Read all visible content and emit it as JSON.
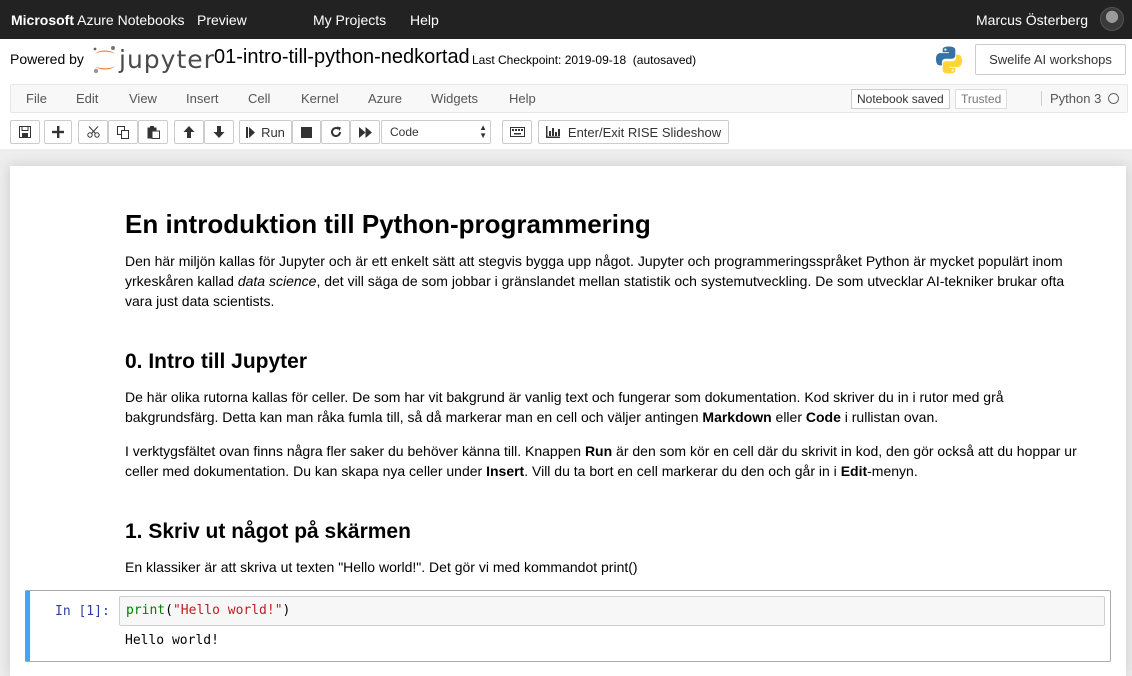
{
  "azure_bar": {
    "brand_bold": "Microsoft",
    "brand_rest": "Azure Notebooks",
    "preview": "Preview",
    "my_projects": "My Projects",
    "help": "Help",
    "user": "Marcus Österberg"
  },
  "header": {
    "powered_by": "Powered by",
    "logo_text": "jupyter",
    "notebook_name": "01-intro-till-python-nedkortad",
    "checkpoint_label": "Last Checkpoint:",
    "checkpoint_date": "2019-09-18",
    "autosaved": "(autosaved)",
    "workshop_button": "Swelife AI workshops"
  },
  "menubar": {
    "items": [
      "File",
      "Edit",
      "View",
      "Insert",
      "Cell",
      "Kernel",
      "Azure",
      "Widgets",
      "Help"
    ],
    "notebook_saved": "Notebook saved",
    "trusted": "Trusted",
    "kernel": "Python 3"
  },
  "toolbar": {
    "run_label": "Run",
    "cell_type": "Code",
    "rise_label": "Enter/Exit RISE Slideshow"
  },
  "content": {
    "title": "En introduktion till Python-programmering",
    "intro_1": "Den här miljön kallas för Jupyter och är ett enkelt sätt att stegvis bygga upp något. Jupyter och programmeringsspråket Python är mycket populärt inom yrkeskåren kallad ",
    "intro_em": "data science",
    "intro_2": ", det vill säga de som jobbar i gränslandet mellan statistik och systemutveckling. De som utvecklar AI-tekniker brukar ofta vara just data scientists.",
    "section0_title": "0. Intro till Jupyter",
    "s0p1_a": "De här olika rutorna kallas för celler. De som har vit bakgrund är vanlig text och fungerar som dokumentation. Kod skriver du in i rutor med grå bakgrundsfärg. Detta kan man råka fumla till, så då markerar man en cell och väljer antingen ",
    "s0p1_b1": "Markdown",
    "s0p1_c": " eller ",
    "s0p1_b2": "Code",
    "s0p1_d": " i rullistan ovan.",
    "s0p2_a": "I verktygsfältet ovan finns några fler saker du behöver känna till. Knappen ",
    "s0p2_b1": "Run",
    "s0p2_c": " är den som kör en cell där du skrivit in kod, den gör också att du hoppar ur celler med dokumentation. Du kan skapa nya celler under ",
    "s0p2_b2": "Insert",
    "s0p2_d": ". Vill du ta bort en cell markerar du den och går in i ",
    "s0p2_b3": "Edit",
    "s0p2_e": "-menyn.",
    "section1_title": "1. Skriv ut något på skärmen",
    "s1p1": "En klassiker är att skriva ut texten \"Hello world!\". Det gör vi med kommandot print()"
  },
  "code_cell": {
    "prompt": "In [1]:",
    "fn": "print",
    "open": "(",
    "string": "\"Hello world!\"",
    "close": ")",
    "output": "Hello world!"
  },
  "colors": {
    "azure_bar": "#222222",
    "jupyter_orange": "#f37726",
    "cell_selected": "#42a5f5",
    "prompt": "#303f9f"
  }
}
